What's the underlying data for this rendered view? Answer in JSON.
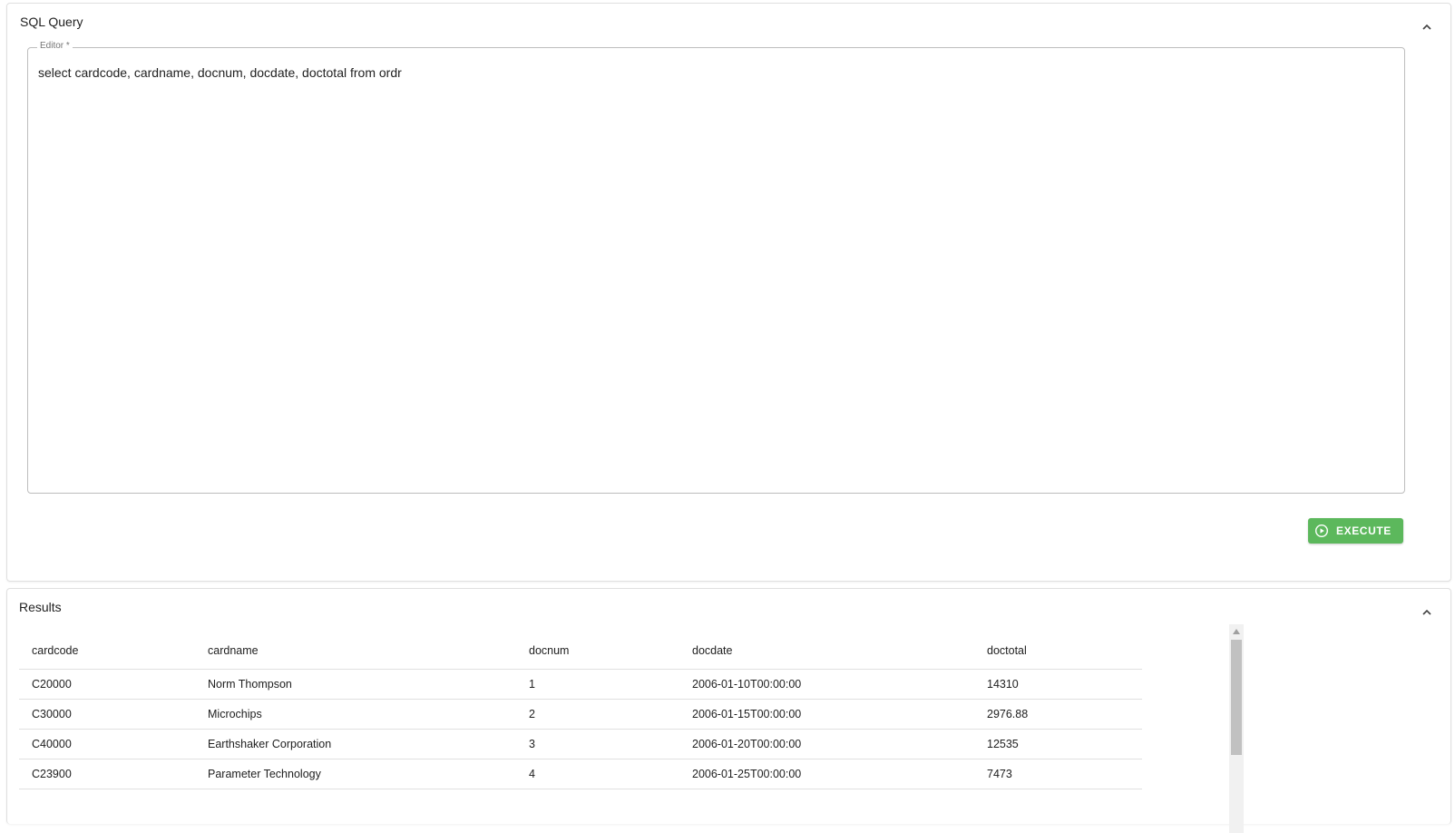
{
  "sql_panel": {
    "title": "SQL Query",
    "editor_label": "Editor *",
    "editor_value": "select cardcode, cardname, docnum, docdate, doctotal from ordr",
    "execute_label": "EXECUTE",
    "execute_color": "#5cb85c"
  },
  "results_panel": {
    "title": "Results",
    "columns": [
      "cardcode",
      "cardname",
      "docnum",
      "docdate",
      "doctotal"
    ],
    "rows": [
      [
        "C20000",
        "Norm Thompson",
        "1",
        "2006-01-10T00:00:00",
        "14310"
      ],
      [
        "C30000",
        "Microchips",
        "2",
        "2006-01-15T00:00:00",
        "2976.88"
      ],
      [
        "C40000",
        "Earthshaker Corporation",
        "3",
        "2006-01-20T00:00:00",
        "12535"
      ],
      [
        "C23900",
        "Parameter Technology",
        "4",
        "2006-01-25T00:00:00",
        "7473"
      ]
    ]
  },
  "icons": {
    "collapse": "chevron-up-icon",
    "execute": "play-circle-icon",
    "scroll_up": "scroll-up-arrow-icon"
  }
}
